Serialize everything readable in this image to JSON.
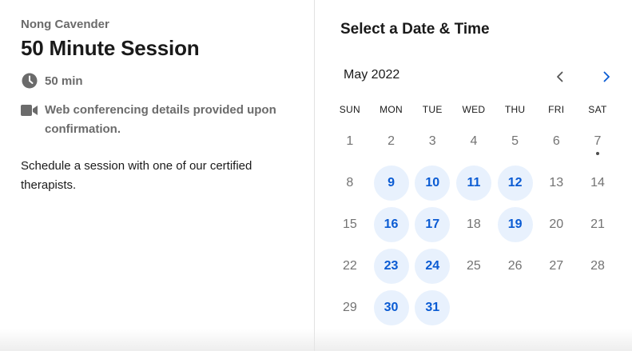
{
  "event": {
    "host": "Nong Cavender",
    "title": "50 Minute Session",
    "duration": "50 min",
    "location": "Web conferencing details provided upon confirmation.",
    "description": "Schedule a session with one of our certified therapists."
  },
  "calendar": {
    "heading": "Select a Date & Time",
    "month_label": "May 2022",
    "weekdays": [
      "SUN",
      "MON",
      "TUE",
      "WED",
      "THU",
      "FRI",
      "SAT"
    ],
    "today": "7",
    "days": [
      {
        "label": "1",
        "available": false
      },
      {
        "label": "2",
        "available": false
      },
      {
        "label": "3",
        "available": false
      },
      {
        "label": "4",
        "available": false
      },
      {
        "label": "5",
        "available": false
      },
      {
        "label": "6",
        "available": false
      },
      {
        "label": "7",
        "available": false
      },
      {
        "label": "8",
        "available": false
      },
      {
        "label": "9",
        "available": true
      },
      {
        "label": "10",
        "available": true
      },
      {
        "label": "11",
        "available": true
      },
      {
        "label": "12",
        "available": true
      },
      {
        "label": "13",
        "available": false
      },
      {
        "label": "14",
        "available": false
      },
      {
        "label": "15",
        "available": false
      },
      {
        "label": "16",
        "available": true
      },
      {
        "label": "17",
        "available": true
      },
      {
        "label": "18",
        "available": false
      },
      {
        "label": "19",
        "available": true
      },
      {
        "label": "20",
        "available": false
      },
      {
        "label": "21",
        "available": false
      },
      {
        "label": "22",
        "available": false
      },
      {
        "label": "23",
        "available": true
      },
      {
        "label": "24",
        "available": true
      },
      {
        "label": "25",
        "available": false
      },
      {
        "label": "26",
        "available": false
      },
      {
        "label": "27",
        "available": false
      },
      {
        "label": "28",
        "available": false
      },
      {
        "label": "29",
        "available": false
      },
      {
        "label": "30",
        "available": true
      },
      {
        "label": "31",
        "available": true
      }
    ]
  },
  "icons": {
    "duration": "clock-icon",
    "location": "video-camera-icon",
    "prev": "chevron-left-icon",
    "next": "chevron-right-icon"
  },
  "colors": {
    "accent": "#0a5bd3",
    "available_bg": "#e8f1fd",
    "muted_text": "#6b6b6b"
  }
}
